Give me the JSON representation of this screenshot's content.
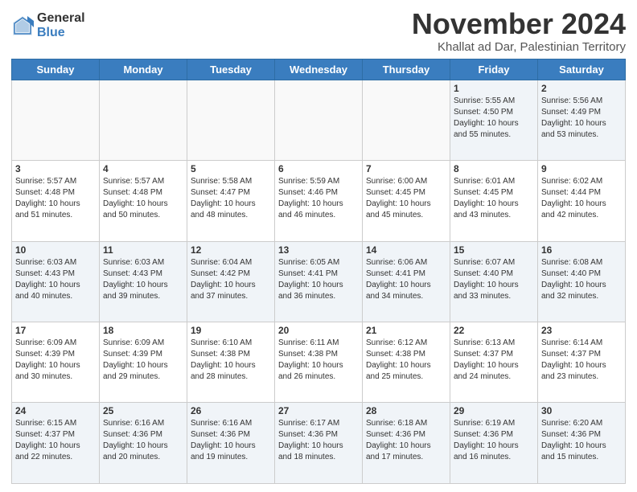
{
  "header": {
    "logo_general": "General",
    "logo_blue": "Blue",
    "month_title": "November 2024",
    "location": "Khallat ad Dar, Palestinian Territory"
  },
  "days_of_week": [
    "Sunday",
    "Monday",
    "Tuesday",
    "Wednesday",
    "Thursday",
    "Friday",
    "Saturday"
  ],
  "weeks": [
    [
      {
        "day": "",
        "info": ""
      },
      {
        "day": "",
        "info": ""
      },
      {
        "day": "",
        "info": ""
      },
      {
        "day": "",
        "info": ""
      },
      {
        "day": "",
        "info": ""
      },
      {
        "day": "1",
        "info": "Sunrise: 5:55 AM\nSunset: 4:50 PM\nDaylight: 10 hours\nand 55 minutes."
      },
      {
        "day": "2",
        "info": "Sunrise: 5:56 AM\nSunset: 4:49 PM\nDaylight: 10 hours\nand 53 minutes."
      }
    ],
    [
      {
        "day": "3",
        "info": "Sunrise: 5:57 AM\nSunset: 4:48 PM\nDaylight: 10 hours\nand 51 minutes."
      },
      {
        "day": "4",
        "info": "Sunrise: 5:57 AM\nSunset: 4:48 PM\nDaylight: 10 hours\nand 50 minutes."
      },
      {
        "day": "5",
        "info": "Sunrise: 5:58 AM\nSunset: 4:47 PM\nDaylight: 10 hours\nand 48 minutes."
      },
      {
        "day": "6",
        "info": "Sunrise: 5:59 AM\nSunset: 4:46 PM\nDaylight: 10 hours\nand 46 minutes."
      },
      {
        "day": "7",
        "info": "Sunrise: 6:00 AM\nSunset: 4:45 PM\nDaylight: 10 hours\nand 45 minutes."
      },
      {
        "day": "8",
        "info": "Sunrise: 6:01 AM\nSunset: 4:45 PM\nDaylight: 10 hours\nand 43 minutes."
      },
      {
        "day": "9",
        "info": "Sunrise: 6:02 AM\nSunset: 4:44 PM\nDaylight: 10 hours\nand 42 minutes."
      }
    ],
    [
      {
        "day": "10",
        "info": "Sunrise: 6:03 AM\nSunset: 4:43 PM\nDaylight: 10 hours\nand 40 minutes."
      },
      {
        "day": "11",
        "info": "Sunrise: 6:03 AM\nSunset: 4:43 PM\nDaylight: 10 hours\nand 39 minutes."
      },
      {
        "day": "12",
        "info": "Sunrise: 6:04 AM\nSunset: 4:42 PM\nDaylight: 10 hours\nand 37 minutes."
      },
      {
        "day": "13",
        "info": "Sunrise: 6:05 AM\nSunset: 4:41 PM\nDaylight: 10 hours\nand 36 minutes."
      },
      {
        "day": "14",
        "info": "Sunrise: 6:06 AM\nSunset: 4:41 PM\nDaylight: 10 hours\nand 34 minutes."
      },
      {
        "day": "15",
        "info": "Sunrise: 6:07 AM\nSunset: 4:40 PM\nDaylight: 10 hours\nand 33 minutes."
      },
      {
        "day": "16",
        "info": "Sunrise: 6:08 AM\nSunset: 4:40 PM\nDaylight: 10 hours\nand 32 minutes."
      }
    ],
    [
      {
        "day": "17",
        "info": "Sunrise: 6:09 AM\nSunset: 4:39 PM\nDaylight: 10 hours\nand 30 minutes."
      },
      {
        "day": "18",
        "info": "Sunrise: 6:09 AM\nSunset: 4:39 PM\nDaylight: 10 hours\nand 29 minutes."
      },
      {
        "day": "19",
        "info": "Sunrise: 6:10 AM\nSunset: 4:38 PM\nDaylight: 10 hours\nand 28 minutes."
      },
      {
        "day": "20",
        "info": "Sunrise: 6:11 AM\nSunset: 4:38 PM\nDaylight: 10 hours\nand 26 minutes."
      },
      {
        "day": "21",
        "info": "Sunrise: 6:12 AM\nSunset: 4:38 PM\nDaylight: 10 hours\nand 25 minutes."
      },
      {
        "day": "22",
        "info": "Sunrise: 6:13 AM\nSunset: 4:37 PM\nDaylight: 10 hours\nand 24 minutes."
      },
      {
        "day": "23",
        "info": "Sunrise: 6:14 AM\nSunset: 4:37 PM\nDaylight: 10 hours\nand 23 minutes."
      }
    ],
    [
      {
        "day": "24",
        "info": "Sunrise: 6:15 AM\nSunset: 4:37 PM\nDaylight: 10 hours\nand 22 minutes."
      },
      {
        "day": "25",
        "info": "Sunrise: 6:16 AM\nSunset: 4:36 PM\nDaylight: 10 hours\nand 20 minutes."
      },
      {
        "day": "26",
        "info": "Sunrise: 6:16 AM\nSunset: 4:36 PM\nDaylight: 10 hours\nand 19 minutes."
      },
      {
        "day": "27",
        "info": "Sunrise: 6:17 AM\nSunset: 4:36 PM\nDaylight: 10 hours\nand 18 minutes."
      },
      {
        "day": "28",
        "info": "Sunrise: 6:18 AM\nSunset: 4:36 PM\nDaylight: 10 hours\nand 17 minutes."
      },
      {
        "day": "29",
        "info": "Sunrise: 6:19 AM\nSunset: 4:36 PM\nDaylight: 10 hours\nand 16 minutes."
      },
      {
        "day": "30",
        "info": "Sunrise: 6:20 AM\nSunset: 4:36 PM\nDaylight: 10 hours\nand 15 minutes."
      }
    ]
  ]
}
